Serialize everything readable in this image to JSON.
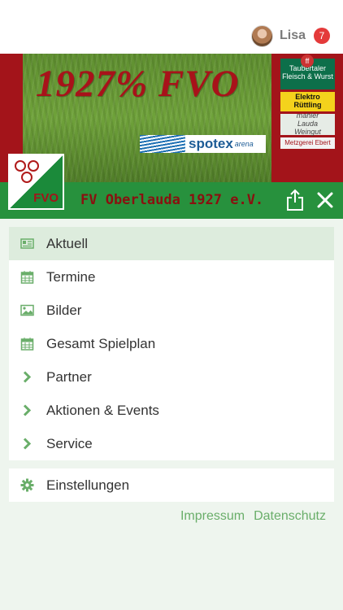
{
  "user": {
    "name": "Lisa",
    "notifications": "7"
  },
  "banner": {
    "slogan": "1927% FVO",
    "spotex_brand": "spotex",
    "spotex_sub": "arena",
    "sponsors": [
      {
        "name": "Taubertaler\nFleisch & Wurst"
      },
      {
        "name": "Elektro\nRüttling"
      },
      {
        "name": "mahler\nLauda\nWeingut"
      },
      {
        "name": "Metzgerei Ebert"
      }
    ],
    "logo_text": "FVO"
  },
  "header": {
    "club_name": "FV Oberlauda 1927 e.V."
  },
  "menu": {
    "items": [
      {
        "label": "Aktuell",
        "icon": "newspaper-icon",
        "active": true
      },
      {
        "label": "Termine",
        "icon": "calendar-icon"
      },
      {
        "label": "Bilder",
        "icon": "image-icon"
      },
      {
        "label": "Gesamt Spielplan",
        "icon": "calendar-icon"
      },
      {
        "label": "Partner",
        "icon": "chevron-right-icon"
      },
      {
        "label": "Aktionen & Events",
        "icon": "chevron-right-icon"
      },
      {
        "label": "Service",
        "icon": "chevron-right-icon"
      }
    ],
    "settings": {
      "label": "Einstellungen",
      "icon": "gear-icon"
    }
  },
  "footer": {
    "impressum": "Impressum",
    "datenschutz": "Datenschutz"
  },
  "colors": {
    "brand_green": "#27913d",
    "brand_red": "#a3141a",
    "icon_green": "#6aae6a"
  }
}
